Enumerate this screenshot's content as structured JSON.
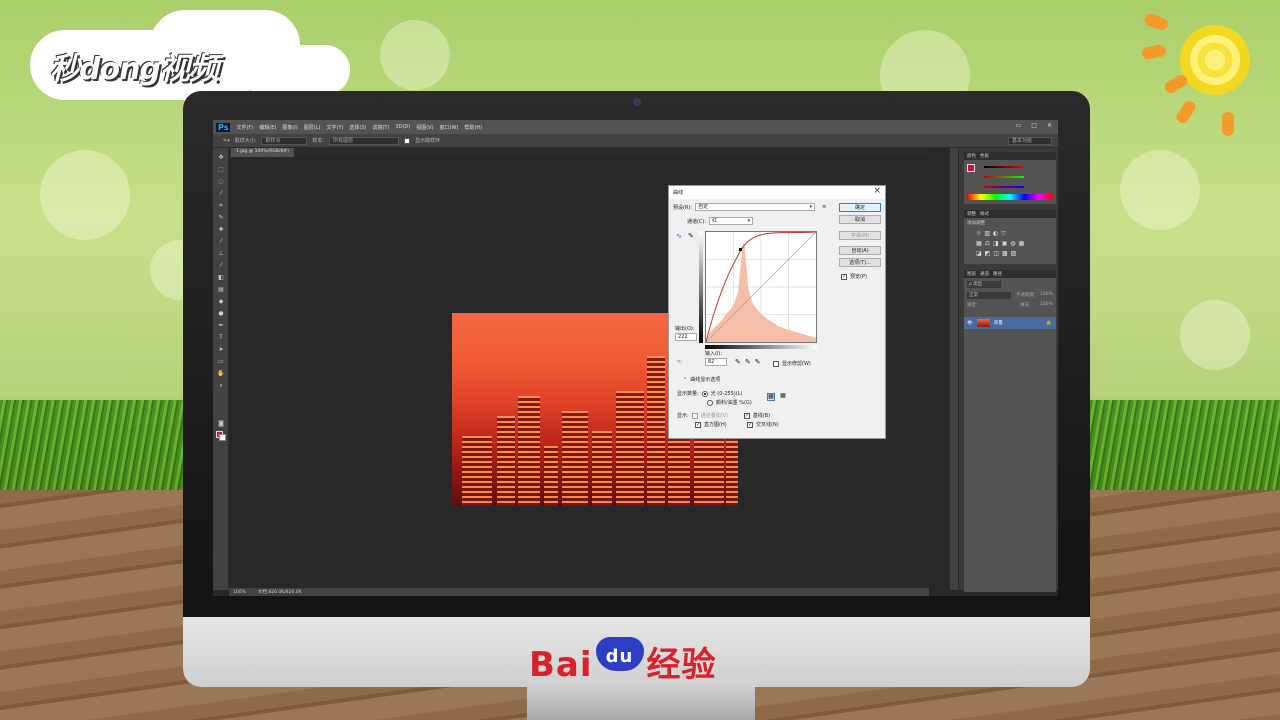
{
  "watermark": {
    "logo": "秒dong视频",
    "brand": "Baidu经验",
    "brand_left": "Bai",
    "brand_mid": "du",
    "brand_right": "经验"
  },
  "ps": {
    "logo": "Ps",
    "menus": [
      "文件(F)",
      "编辑(E)",
      "图像(I)",
      "图层(L)",
      "文字(Y)",
      "选择(S)",
      "滤镜(T)",
      "3D(D)",
      "视图(V)",
      "窗口(W)",
      "帮助(H)"
    ],
    "window_controls": [
      "▭",
      "□",
      "✕"
    ],
    "options": {
      "sample_size_label": "取样大小:",
      "sample_size_value": "取样点",
      "sample_label": "样本:",
      "sample_value": "所有图层",
      "show_ring_label": "显示取样环"
    },
    "workspace": "基本功能",
    "doc_tab": "1.jpg @ 100%(RGB/8#)",
    "status": {
      "zoom": "100%",
      "doc": "文档:826.0K/826.0K"
    },
    "panels": {
      "color_tabs": [
        "颜色",
        "色板"
      ],
      "adjust_tabs": [
        "调整",
        "样式"
      ],
      "adjust_hint": "添加调整",
      "layer_tabs": [
        "图层",
        "通道",
        "路径"
      ],
      "kind": "ρ 类型",
      "blend": "正常",
      "opacity_label": "不透明度:",
      "opacity": "100%",
      "fill_label": "填充:",
      "fill": "100%",
      "lock_label": "锁定:",
      "layer_name": "背景"
    }
  },
  "curves": {
    "title": "曲线",
    "preset_label": "预设(R):",
    "preset_value": "自定",
    "channel_label": "通道(C):",
    "channel_value": "红",
    "buttons": {
      "ok": "确定",
      "cancel": "取消",
      "smooth": "平滑(M)",
      "auto": "自动(A)",
      "options": "选项(T)...",
      "preview": "预览(P)"
    },
    "output_label": "输出(O):",
    "output_value": "222",
    "input_label": "输入(I):",
    "input_value": "82",
    "show_clipping": "显示修剪(W)",
    "display_options": "曲线显示选项",
    "show_amount_label": "显示数量:",
    "light": "光 (0-255)(L)",
    "pigment": "颜料/油墨 %(G)",
    "show_label": "显示:",
    "channel_overlays": "通道叠加(V)",
    "baseline": "基线(B)",
    "histogram": "直方图(H)",
    "intersection": "交叉线(N)"
  },
  "colors": {
    "accent_red": "#c0163a",
    "ps_blue": "#31a8ff",
    "baidu_red": "#d8212b",
    "baidu_blue": "#2d3ec4"
  }
}
